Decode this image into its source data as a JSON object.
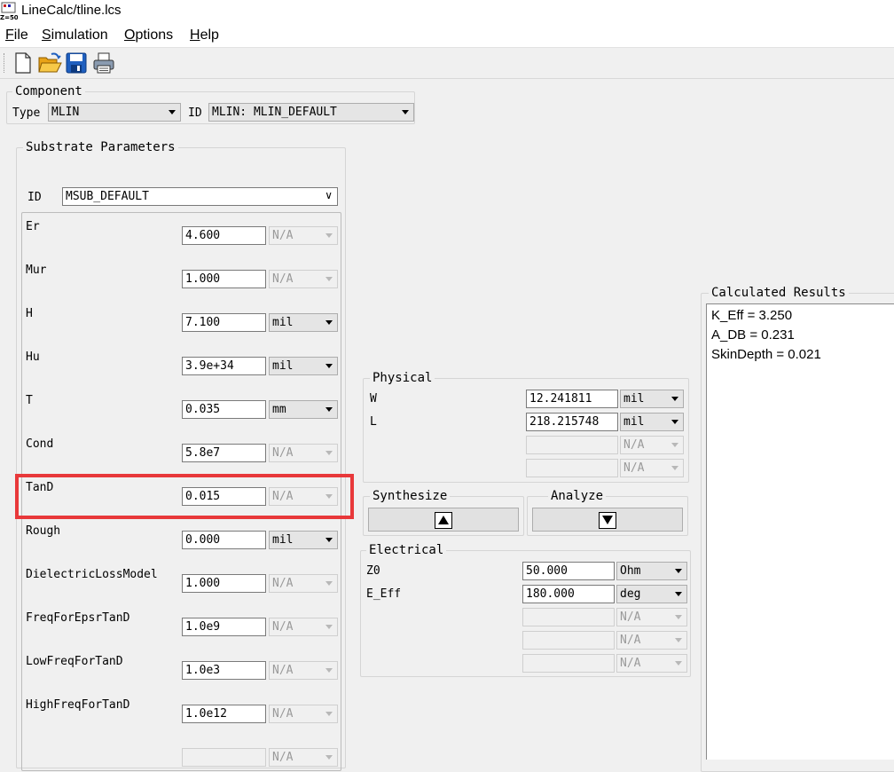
{
  "window": {
    "title": "LineCalc/tline.lcs",
    "icon_text": "Z=50"
  },
  "menu": [
    {
      "label": "File",
      "accel": "F",
      "rest": "ile"
    },
    {
      "label": "Simulation",
      "accel": "S",
      "rest": "imulation"
    },
    {
      "label": "Options",
      "accel": "O",
      "rest": "ptions"
    },
    {
      "label": "Help",
      "accel": "H",
      "rest": "elp"
    }
  ],
  "toolbar": {
    "icons": [
      "new-file-icon",
      "open-folder-icon",
      "save-disk-icon",
      "print-icon"
    ]
  },
  "component": {
    "group_title": "Component",
    "type_label": "Type",
    "type_value": "MLIN",
    "id_label": "ID",
    "id_value": "MLIN: MLIN_DEFAULT"
  },
  "substrate": {
    "group_title": "Substrate Parameters",
    "id_label": "ID",
    "id_value": "MSUB_DEFAULT",
    "params": [
      {
        "name": "Er",
        "value": "4.600",
        "unit": "N/A"
      },
      {
        "name": "Mur",
        "value": "1.000",
        "unit": "N/A"
      },
      {
        "name": "H",
        "value": "7.100",
        "unit": "mil"
      },
      {
        "name": "Hu",
        "value": "3.9e+34",
        "unit": "mil"
      },
      {
        "name": "T",
        "value": "0.035",
        "unit": "mm"
      },
      {
        "name": "Cond",
        "value": "5.8e7",
        "unit": "N/A"
      },
      {
        "name": "TanD",
        "value": "0.015",
        "unit": "N/A"
      },
      {
        "name": "Rough",
        "value": "0.000",
        "unit": "mil"
      },
      {
        "name": "DielectricLossModel",
        "value": "1.000",
        "unit": "N/A"
      },
      {
        "name": "FreqForEpsrTanD",
        "value": "1.0e9",
        "unit": "N/A"
      },
      {
        "name": "LowFreqForTanD",
        "value": "1.0e3",
        "unit": "N/A"
      },
      {
        "name": "HighFreqForTanD",
        "value": "1.0e12",
        "unit": "N/A"
      },
      {
        "name": "",
        "value": "",
        "unit": "N/A"
      }
    ]
  },
  "physical": {
    "group_title": "Physical",
    "rows": [
      {
        "name": "W",
        "value": "12.241811",
        "unit": "mil"
      },
      {
        "name": "L",
        "value": "218.215748",
        "unit": "mil"
      },
      {
        "name": "",
        "value": "",
        "unit": "N/A"
      },
      {
        "name": "",
        "value": "",
        "unit": "N/A"
      }
    ]
  },
  "synthesize": {
    "group_title": "Synthesize"
  },
  "analyze": {
    "group_title": "Analyze"
  },
  "electrical": {
    "group_title": "Electrical",
    "rows": [
      {
        "name": "Z0",
        "value": "50.000",
        "unit": "Ohm"
      },
      {
        "name": "E_Eff",
        "value": "180.000",
        "unit": "deg"
      },
      {
        "name": "",
        "value": "",
        "unit": "N/A"
      },
      {
        "name": "",
        "value": "",
        "unit": "N/A"
      },
      {
        "name": "",
        "value": "",
        "unit": "N/A"
      }
    ]
  },
  "results": {
    "group_title": "Calculated Results",
    "lines": [
      "K_Eff = 3.250",
      "A_DB = 0.231",
      "SkinDepth = 0.021"
    ]
  },
  "colors": {
    "highlight": "#e8383a",
    "window_bg": "#f0f0f0"
  }
}
